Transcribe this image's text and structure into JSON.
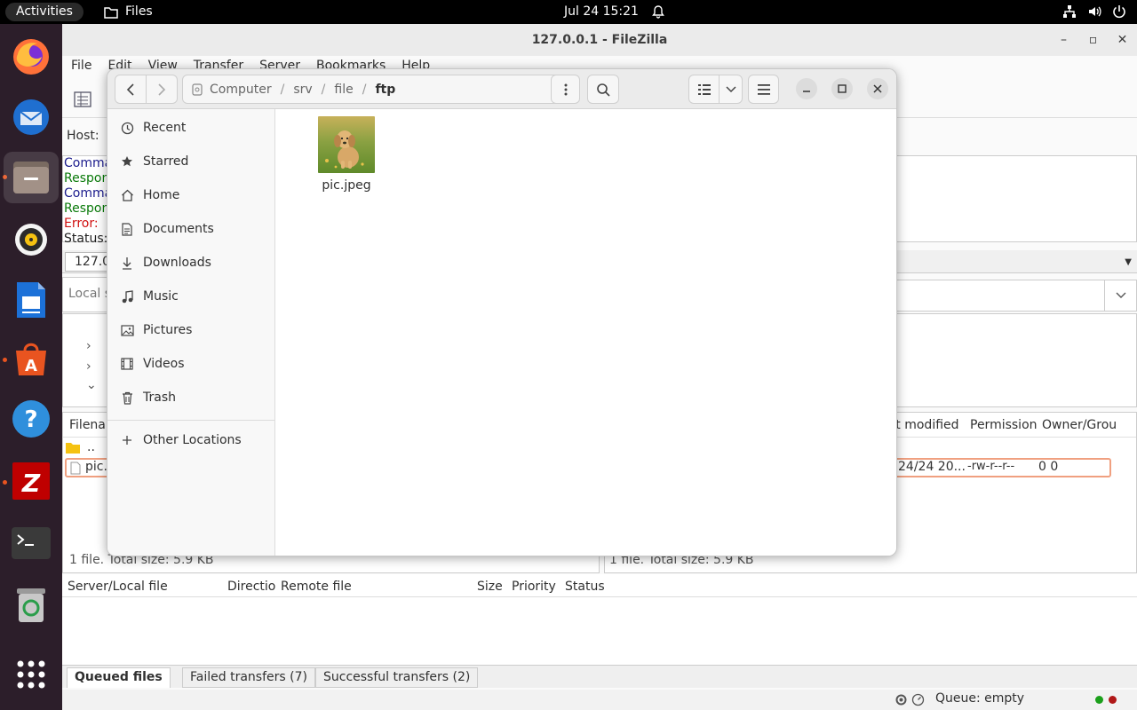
{
  "topbar": {
    "activities": "Activities",
    "app_name": "Files",
    "clock": "Jul 24  15:21"
  },
  "dock": {
    "items": [
      "firefox-icon",
      "thunderbird-icon",
      "files-icon",
      "rhythmbox-icon",
      "writer-icon",
      "app-center-icon",
      "help-icon",
      "filezilla-icon",
      "terminal-icon",
      "trash-icon",
      "app-grid-icon"
    ]
  },
  "filezilla": {
    "title": "127.0.0.1 - FileZilla",
    "menu": [
      "File",
      "Edit",
      "View",
      "Transfer",
      "Server",
      "Bookmarks",
      "Help"
    ],
    "host_label": "Host:",
    "log": [
      {
        "text": "Comma",
        "color": "#1a1a8c"
      },
      {
        "text": "Respon",
        "color": "#0a7a0a"
      },
      {
        "text": "Comma",
        "color": "#1a1a8c"
      },
      {
        "text": "Respon",
        "color": "#0a7a0a"
      },
      {
        "text": "Error:",
        "color": "#d01010"
      },
      {
        "text": "Status:",
        "color": "#202020"
      }
    ],
    "site_tab": "127.0",
    "local_site_label": "Local s",
    "local_list": {
      "header": "Filenar",
      "parent": "..",
      "file": "pic.",
      "status": "1 file. Total size: 5.9 KB"
    },
    "remote_list": {
      "headers": [
        "st modified",
        "Permission",
        "Owner/Grou"
      ],
      "row": {
        "modified": "24/24 20...",
        "permission": "-rw-r--r--",
        "owner": "0 0"
      },
      "status": "1 file. Total size: 5.9 KB"
    },
    "queue_headers": [
      "Server/Local file",
      "Directio",
      "Remote file",
      "Size",
      "Priority",
      "Status"
    ],
    "bottom_tabs": [
      "Queued files",
      "Failed transfers (7)",
      "Successful transfers (2)"
    ],
    "queue_status": "Queue: empty"
  },
  "files": {
    "path": [
      "Computer",
      "srv",
      "file"
    ],
    "path_current": "ftp",
    "sidebar": [
      {
        "label": "Recent",
        "icon": "clock-icon"
      },
      {
        "label": "Starred",
        "icon": "star-icon"
      },
      {
        "label": "Home",
        "icon": "home-icon"
      },
      {
        "label": "Documents",
        "icon": "document-icon"
      },
      {
        "label": "Downloads",
        "icon": "download-icon"
      },
      {
        "label": "Music",
        "icon": "music-icon"
      },
      {
        "label": "Pictures",
        "icon": "picture-icon"
      },
      {
        "label": "Videos",
        "icon": "video-icon"
      },
      {
        "label": "Trash",
        "icon": "trash-icon"
      }
    ],
    "other_locations": "Other Locations",
    "file_name": "pic.jpeg"
  }
}
